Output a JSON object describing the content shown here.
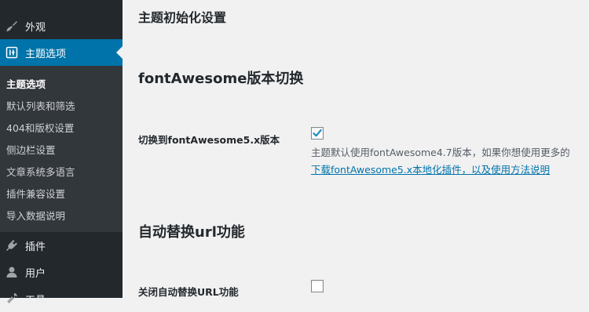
{
  "sidebar": {
    "appearance_label": "外观",
    "theme_options_label": "主题选项",
    "submenu": [
      "主题选项",
      "默认列表和筛选",
      "404和版权设置",
      "侧边栏设置",
      "文章系统多语言",
      "插件兼容设置",
      "导入数据说明"
    ],
    "plugins_label": "插件",
    "users_label": "用户",
    "tools_label": "工具"
  },
  "main": {
    "page_title": "主题初始化设置",
    "section_fontawesome": {
      "title": "fontAwesome版本切换",
      "row_label": "切换到fontAwesome5.x版本",
      "checked": true,
      "description": "主题默认使用fontAwesome4.7版本，如果你想使用更多的",
      "link_text": "下载fontAwesome5.x本地化插件，以及使用方法说明"
    },
    "section_url": {
      "title": "自动替换url功能",
      "row_label": "关闭自动替换URL功能",
      "checked": false
    }
  },
  "colors": {
    "sidebar_bg": "#23282d",
    "submenu_bg": "#32373c",
    "accent": "#0073aa",
    "page_bg": "#f1f1f1"
  }
}
